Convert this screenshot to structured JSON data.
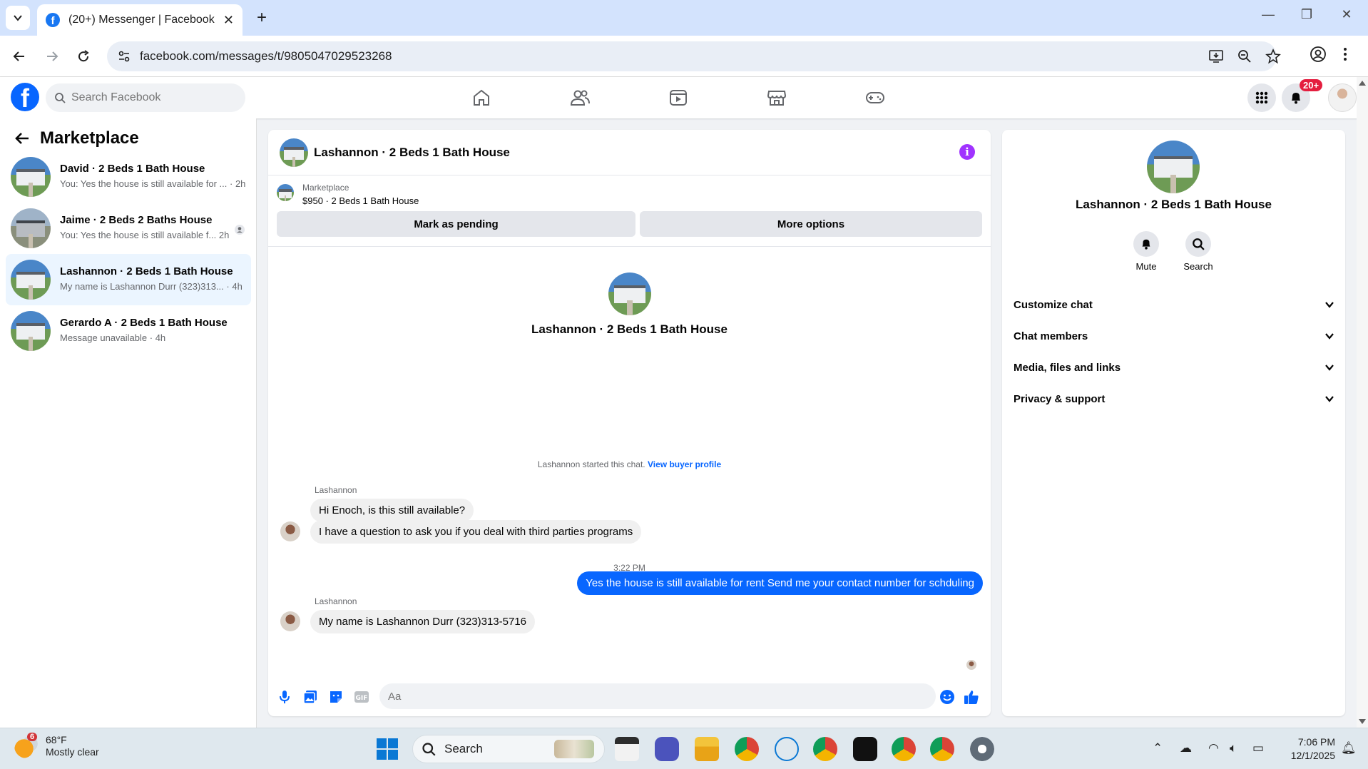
{
  "browser": {
    "tab_title": "(20+) Messenger | Facebook",
    "url": "facebook.com/messages/t/9805047029523268"
  },
  "fb": {
    "search_placeholder": "Search Facebook",
    "notification_badge": "20+"
  },
  "sidebar": {
    "title": "Marketplace",
    "conversations": [
      {
        "name": "David · 2 Beds 1 Bath House",
        "snippet": "You: Yes the house is still available for ... · 2h"
      },
      {
        "name": "Jaime · 2 Beds 2 Baths House",
        "snippet": "You: Yes the house is still available f... 2h"
      },
      {
        "name": "Lashannon · 2 Beds 1 Bath House",
        "snippet": "My name is Lashannon Durr (323)313... · 4h"
      },
      {
        "name": "Gerardo A · 2 Beds 1 Bath House",
        "snippet": "Message unavailable · 4h"
      }
    ]
  },
  "chat": {
    "title": "Lashannon · 2 Beds 1 Bath House",
    "listing_label": "Marketplace",
    "listing_price": "$950 · 2 Beds 1 Bath House",
    "mark_pending": "Mark as pending",
    "more_options": "More options",
    "center_name": "Lashannon · 2 Beds 1 Bath House",
    "started_text": "Lashannon started this chat.",
    "buyer_link": "View buyer profile",
    "sender": "Lashannon",
    "msg1": "Hi Enoch, is this still available?",
    "msg2": "I have a question to ask you if you deal with third parties programs",
    "timestamp": "3:22 PM",
    "msg3": "Yes the house is still available for rent Send me your contact number for schduling",
    "msg4": "My name is Lashannon Durr (323)313-5716",
    "composer_placeholder": "Aa"
  },
  "info": {
    "name": "Lashannon · 2 Beds 1 Bath House",
    "mute": "Mute",
    "search": "Search",
    "sections": [
      "Customize chat",
      "Chat members",
      "Media, files and links",
      "Privacy & support"
    ]
  },
  "taskbar": {
    "weather_badge": "6",
    "temp": "68°F",
    "condition": "Mostly clear",
    "search": "Search",
    "time": "7:06 PM",
    "date": "12/1/2025"
  },
  "colors": {
    "fb_blue": "#0866ff",
    "active_row": "#ebf5ff",
    "info_purple": "#a033ff"
  }
}
